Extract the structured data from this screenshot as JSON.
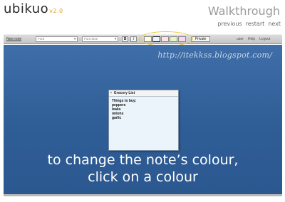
{
  "header": {
    "logo_text": "ubikuo",
    "logo_version": "v2.0",
    "walkthrough_title": "Walkthrough",
    "nav": [
      "previous",
      "restart",
      "next"
    ]
  },
  "toolbar": {
    "new_note_label": "New note",
    "font_select": "Font",
    "font_size_select": "Font Size",
    "bold_label": "B",
    "italic_label": "I",
    "swatch_colors": [
      "#fffce0",
      "#eaf4fa",
      "#fde3e3",
      "#e6f5c6",
      "#fbd6f2"
    ],
    "private_label": "Private",
    "user_link": "user",
    "help_link": "Help",
    "logout_link": "Logout",
    "highlight_color": "#e9c93a"
  },
  "watermark": "http://itekkss.blogspot.com/",
  "note": {
    "title": "Grocery List",
    "lines": [
      "Things to buy:",
      "peppers",
      "leaks",
      "onions",
      "garlic"
    ]
  },
  "caption": {
    "line1": "to change the note’s colour,",
    "line2": "click on a colour"
  },
  "colors": {
    "workspace": "#3a6aa5",
    "note_background": "#eaf4fa"
  }
}
